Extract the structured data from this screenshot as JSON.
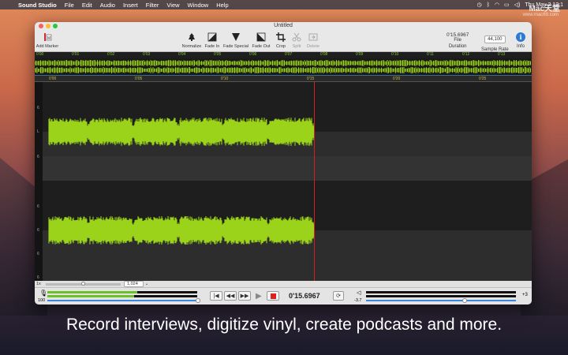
{
  "menubar": {
    "app_name": "Sound Studio",
    "items": [
      "File",
      "Edit",
      "Audio",
      "Insert",
      "Filter",
      "View",
      "Window",
      "Help"
    ],
    "clock": "Thu May 2 12:1",
    "watermark": "Mac天堂",
    "watermark_url": "www.mac69.com"
  },
  "window": {
    "title": "Untitled",
    "toolbar": {
      "add_marker": "Add Marker",
      "normalize": "Normalize",
      "fade_in": "Fade In",
      "fade_special": "Fade Special",
      "fade_out": "Fade Out",
      "crop": "Crop",
      "split": "Split",
      "delete": "Delete",
      "duration_value": "0'15.6967",
      "duration_sub": "File",
      "duration_label": "Duration",
      "sample_rate_value": "44,100",
      "sample_rate_label": "Sample Rate",
      "info_label": "Info"
    },
    "overview_ticks": [
      "0'00",
      "0'01",
      "0'02",
      "0'03",
      "0'04",
      "0'05",
      "0'06",
      "0'07",
      "0'08",
      "0'09",
      "0'10",
      "0'11",
      "0'12",
      "0'13"
    ],
    "main_ticks": [
      "0'00",
      "0'05",
      "0'10",
      "0'15",
      "0'20",
      "0'25"
    ],
    "channel_labels": [
      "6",
      "L",
      "6",
      "6",
      "6",
      "6",
      "6"
    ],
    "zoom": {
      "level_label": "1x",
      "value": "1,024"
    },
    "transport": {
      "input_level": "100",
      "time": "0'15.6967",
      "output_db": "-3.7",
      "output_gain": "+3"
    }
  },
  "caption": "Record interviews, digitize vinyl, create podcasts and more.",
  "colors": {
    "waveform": "#9ad319",
    "playhead": "#d02020",
    "accent": "#3a86d8"
  }
}
